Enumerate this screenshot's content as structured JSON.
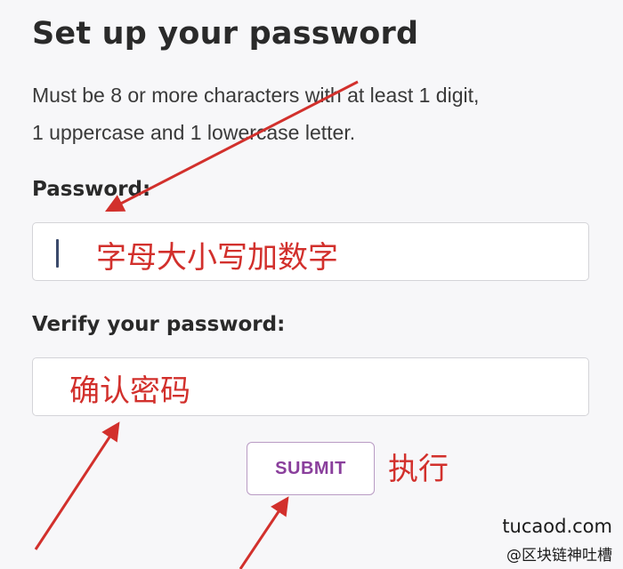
{
  "form": {
    "title": "Set up your password",
    "description_line1": "Must be 8 or more characters with at least 1 digit,",
    "description_line2": "1 uppercase and 1 lowercase letter.",
    "password_label": "Password:",
    "password_value": "",
    "verify_label": "Verify your password:",
    "verify_value": "",
    "submit_label": "SUBMIT"
  },
  "annotations": {
    "password_note": "字母大小写加数字",
    "verify_note": "确认密码",
    "submit_note": "执行",
    "color": "#d2302c"
  },
  "watermark": {
    "site": "tucaod.com",
    "handle": "@区块链神吐槽"
  },
  "colors": {
    "background": "#f7f7f9",
    "submit_text": "#8a3f9c",
    "submit_border": "#b99bc4",
    "input_border": "#d4d4d8"
  }
}
